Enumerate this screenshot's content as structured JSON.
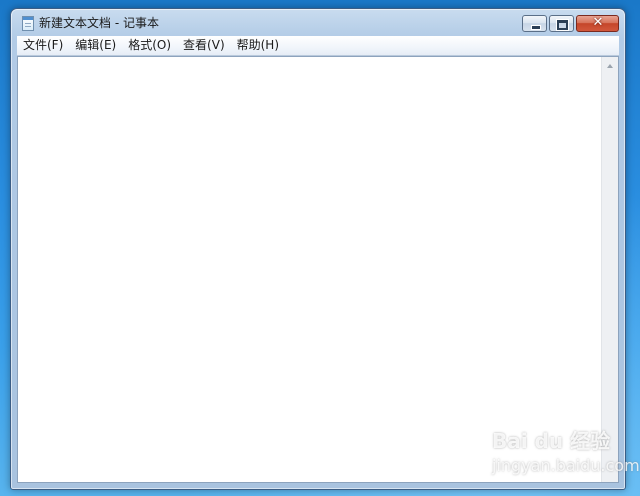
{
  "window": {
    "title": "新建文本文档 - 记事本",
    "icon": "notepad-icon"
  },
  "caption_buttons": {
    "minimize_icon": "minimize-icon",
    "maximize_icon": "maximize-icon",
    "close_icon": "close-icon",
    "close_glyph": "✕"
  },
  "menu": {
    "items": [
      {
        "label": "文件(F)"
      },
      {
        "label": "编辑(E)"
      },
      {
        "label": "格式(O)"
      },
      {
        "label": "查看(V)"
      },
      {
        "label": "帮助(H)"
      }
    ]
  },
  "editor": {
    "content": ""
  },
  "watermark": {
    "brand": "Bai du 经验",
    "sub": "jingyan.baidu.com"
  },
  "colors": {
    "desktop": "#2a8ee0",
    "frame": "#b7cfe8",
    "close": "#c4462a"
  }
}
